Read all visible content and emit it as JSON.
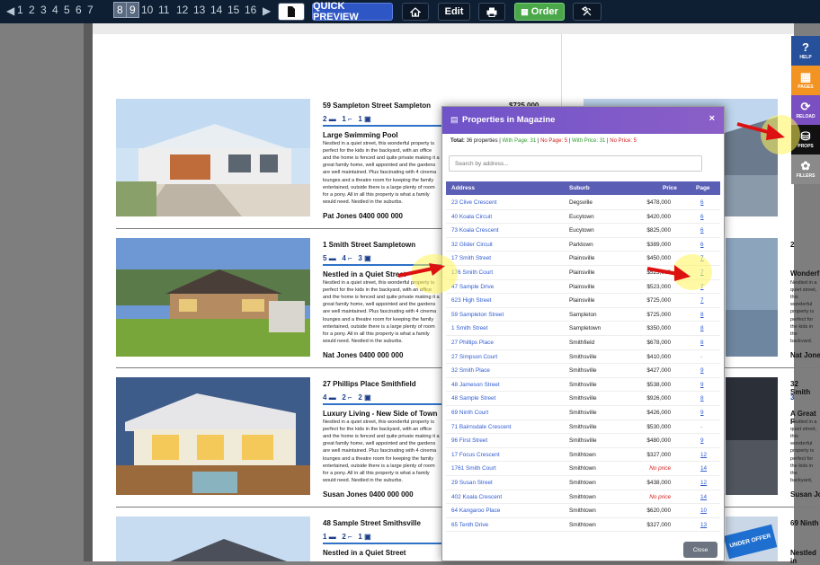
{
  "toolbar": {
    "pages": [
      "1",
      "2",
      "3",
      "4",
      "5",
      "6",
      "7",
      "8",
      "9",
      "10",
      "11",
      "12",
      "13",
      "14",
      "15",
      "16"
    ],
    "selected_pages": [
      "8",
      "9"
    ],
    "quick_preview_label": "QUICK PREVIEW",
    "edit_label": "Edit",
    "order_label": "Order"
  },
  "listings_left": [
    {
      "title": "59 Sampleton Street Sampleton",
      "price": "$725,000",
      "beds": "2",
      "baths": "1",
      "cars": "1",
      "headline": "Large Swimming Pool",
      "agent": "Pat Jones 0400 000 000"
    },
    {
      "title": "1 Smith Street Sampletown",
      "beds": "5",
      "baths": "4",
      "cars": "3",
      "headline": "Nestled in a Quiet Street",
      "agent": "Nat Jones 0400 000 000"
    },
    {
      "title": "27 Phillips Place Smithfield",
      "beds": "4",
      "baths": "2",
      "cars": "2",
      "headline": "Luxury Living - New Side of Town",
      "agent": "Susan Jones 0400 000 000"
    },
    {
      "title": "48 Sample Street Smithsville",
      "beds": "1",
      "baths": "2",
      "cars": "1",
      "headline": "Nestled in a Quiet Street"
    }
  ],
  "listing_desc": "Nestled in a quiet street, this wonderful property is perfect for the kids in the backyard, with an office and the home is fenced and quite private making it a great family home, well appointed and the gardens are well maintained. Plus fascinating with 4 cinema lounges and a theatre room for keeping the family entertained, outside there is a large plenty of room for a pony. All in all this property is what a family would need. Nestled in the suburbs.",
  "listings_right": [
    {
      "title": "2",
      "headline": "Wonderf"
    },
    {
      "title": "32 Smith",
      "beds": "3",
      "headline": "A Great F"
    },
    {
      "title": "69 Ninth",
      "headline": "Nestled in"
    }
  ],
  "right_agents": [
    "Nat Jones",
    "Susan Jones"
  ],
  "under_offer": "UNDER OFFER",
  "side_panel": [
    {
      "label": "HELP",
      "icon": "?",
      "color": "#27509a"
    },
    {
      "label": "PAGES",
      "icon": "▦",
      "color": "#f39322"
    },
    {
      "label": "RELOAD",
      "icon": "⟳",
      "color": "#7a4fc2"
    },
    {
      "label": "PROPS",
      "icon": "⛁",
      "color": "#111111"
    },
    {
      "label": "FILLERS",
      "icon": "✿",
      "color": "#8a8a8a"
    }
  ],
  "modal": {
    "title": "Properties in Magazine",
    "close_x": "×",
    "summary": {
      "total_label": "Total:",
      "total": "36 properties",
      "with_page": "With Page: 31",
      "no_page": "No Page: 5",
      "with_price": "With Price: 31",
      "no_price": "No Price: 5"
    },
    "search_placeholder": "Search by address...",
    "columns": [
      "Address",
      "Suburb",
      "Price",
      "Page"
    ],
    "rows": [
      [
        "23 Clive Crescent",
        "Degsville",
        "$478,000",
        "6"
      ],
      [
        "40 Koala Circuit",
        "Eucytown",
        "$420,000",
        "6"
      ],
      [
        "73 Koala Crescent",
        "Eucytown",
        "$825,000",
        "6"
      ],
      [
        "32 Glider Circuit",
        "Parktown",
        "$389,000",
        "6"
      ],
      [
        "17 Smith Street",
        "Plainsville",
        "$450,000",
        "7"
      ],
      [
        "176 Smith Court",
        "Plainsville",
        "$523,000",
        "7"
      ],
      [
        "47 Sample Drive",
        "Plainsville",
        "$523,000",
        "7"
      ],
      [
        "623 High Street",
        "Plainsville",
        "$725,000",
        "7"
      ],
      [
        "59 Sampleton Street",
        "Sampleton",
        "$725,000",
        "8"
      ],
      [
        "1 Smith Street",
        "Sampletown",
        "$350,000",
        "8"
      ],
      [
        "27 Phillips Place",
        "Smithfield",
        "$678,000",
        "8"
      ],
      [
        "27 Simpson Court",
        "Smithsville",
        "$410,000",
        "-"
      ],
      [
        "32 Smith Place",
        "Smithsville",
        "$427,000",
        "9"
      ],
      [
        "48 Jameson Street",
        "Smithsville",
        "$538,000",
        "9"
      ],
      [
        "48 Sample Street",
        "Smithsville",
        "$926,000",
        "8"
      ],
      [
        "69 Ninth Court",
        "Smithsville",
        "$426,000",
        "9"
      ],
      [
        "71 Bairnsdale Crescent",
        "Smithsville",
        "$530,000",
        "-"
      ],
      [
        "96 First Street",
        "Smithsville",
        "$480,000",
        "9"
      ],
      [
        "17 Focus Crescent",
        "Smithtown",
        "$327,000",
        "12"
      ],
      [
        "1761 Smith Court",
        "Smithtown",
        "No price",
        "14"
      ],
      [
        "29 Susan Street",
        "Smithtown",
        "$438,000",
        "12"
      ],
      [
        "402 Koala Crescent",
        "Smithtown",
        "No price",
        "14"
      ],
      [
        "64 Kangaroo Place",
        "Smithtown",
        "$620,000",
        "10"
      ],
      [
        "65 Tenth Drive",
        "Smithtown",
        "$327,000",
        "13"
      ]
    ],
    "close_label": "Close"
  },
  "colors": {
    "toolbar": "#0f1f33",
    "modal_header": "#7b58c8",
    "table_header": "#5a5fb5",
    "link": "#2f5bd2",
    "no_price": "#d21b1b"
  }
}
